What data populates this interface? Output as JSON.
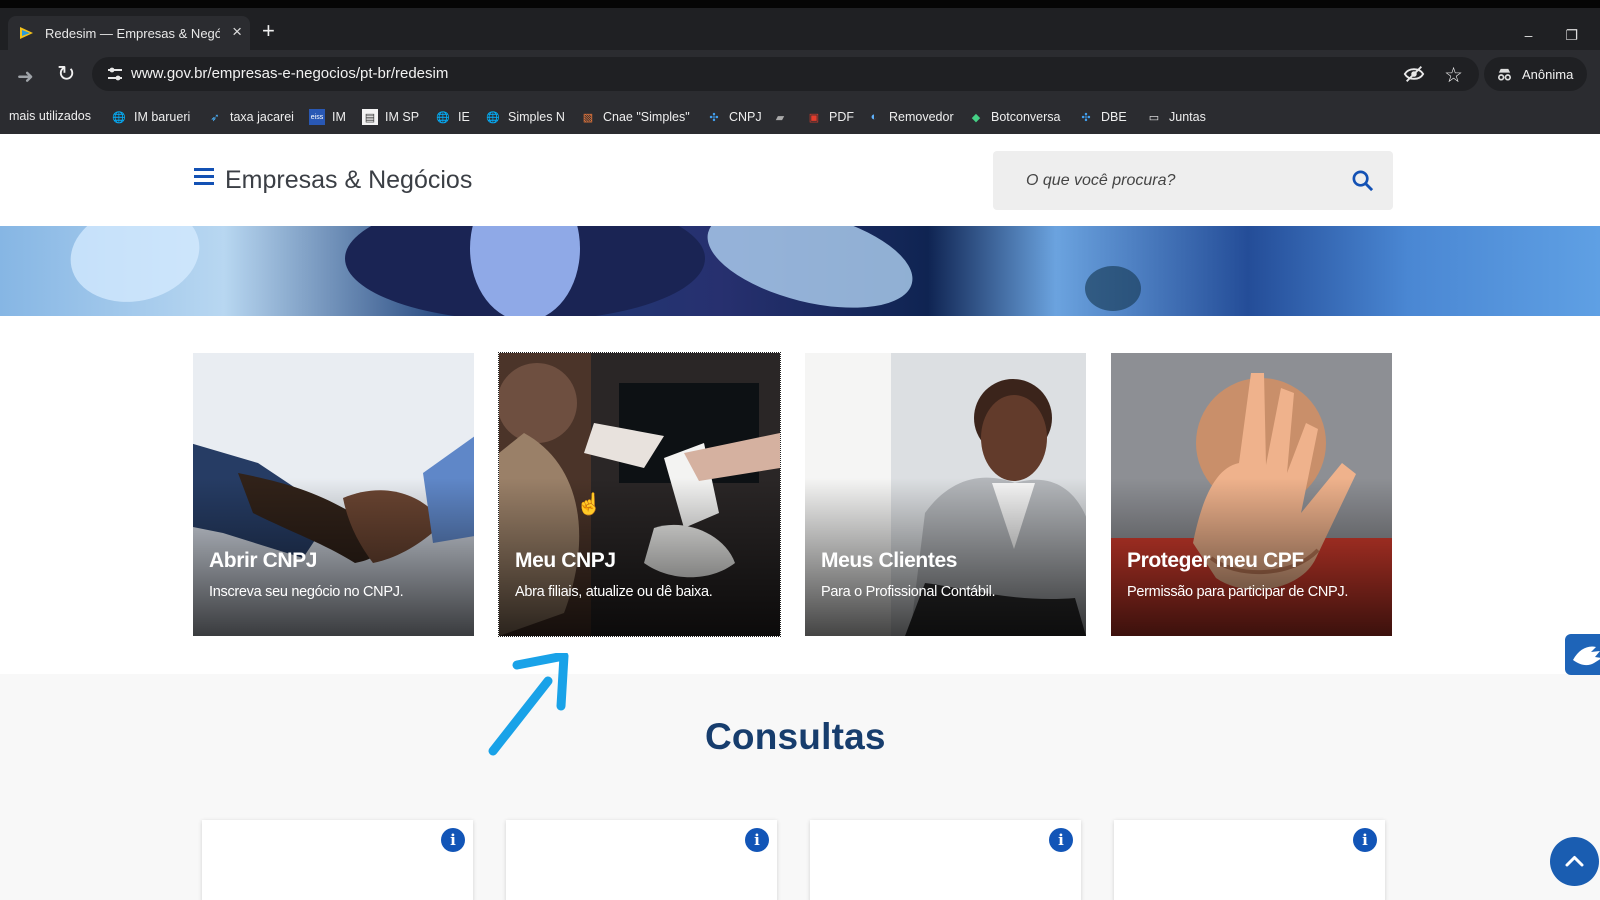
{
  "browser": {
    "tab_title": "Redesim — Empresas & Negóc",
    "tab_close": "×",
    "new_tab": "+",
    "window_minimize": "–",
    "window_restore": "❐",
    "url": "www.gov.br/empresas-e-negocios/pt-br/redesim",
    "profile": "Anônima",
    "bookmarks": [
      {
        "label": "mais utilizados",
        "icon": "none"
      },
      {
        "label": "IM barueri",
        "icon": "globe-icon"
      },
      {
        "label": "taxa jacarei",
        "icon": "bird-icon"
      },
      {
        "label": "IM",
        "icon": "eiss-icon"
      },
      {
        "label": "IM SP",
        "icon": "document-icon"
      },
      {
        "label": "IE",
        "icon": "globe-icon"
      },
      {
        "label": "Simples N",
        "icon": "globe-icon"
      },
      {
        "label": "Cnae \"Simples\"",
        "icon": "striped-icon"
      },
      {
        "label": "CNPJ",
        "icon": "receita-icon"
      },
      {
        "label": "",
        "icon": "flag-icon"
      },
      {
        "label": "PDF",
        "icon": "pdf-icon"
      },
      {
        "label": "Removedor",
        "icon": "remove-icon"
      },
      {
        "label": "Botconversa",
        "icon": "bot-icon"
      },
      {
        "label": "DBE",
        "icon": "receita-icon"
      },
      {
        "label": "Juntas",
        "icon": "folder-icon"
      }
    ]
  },
  "site": {
    "title": "Empresas & Negócios",
    "search_placeholder": "O que você procura?",
    "cards": [
      {
        "title": "Abrir CNPJ",
        "description": "Inscreva seu negócio no CNPJ."
      },
      {
        "title": "Meu CNPJ",
        "description": "Abra filiais, atualize ou dê baixa."
      },
      {
        "title": "Meus Clientes",
        "description": "Para o Profissional Contábil."
      },
      {
        "title": "Proteger meu CPF",
        "description": "Permissão para participar de CNPJ."
      }
    ],
    "consultas_title": "Consultas",
    "info_icon_text": "i"
  },
  "colors": {
    "browser_bg": "#2b2c30",
    "gov_blue": "#1255b7",
    "heading_blue": "#173d6d",
    "annotation_blue": "#19a2e8"
  }
}
